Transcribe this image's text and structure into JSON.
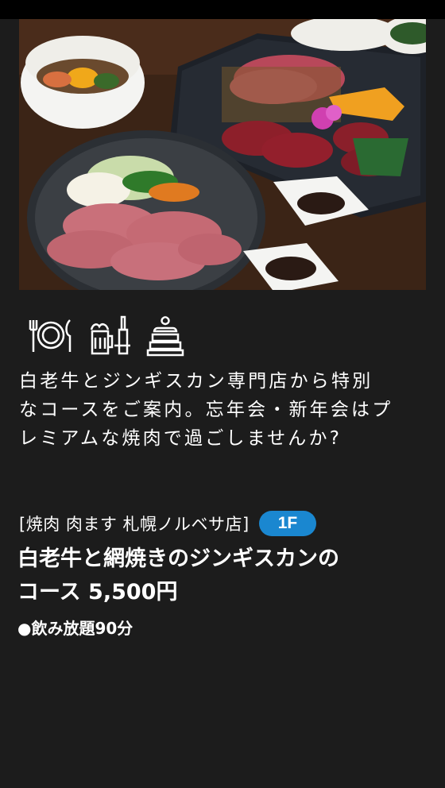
{
  "photo": {
    "alt": ""
  },
  "icons": [
    {
      "name": "dining-plate-icon"
    },
    {
      "name": "beer-drinks-icon"
    },
    {
      "name": "layer-cake-icon"
    }
  ],
  "description": {
    "line1": "白老牛とジンギスカン専門店から特別",
    "line2": "なコースをご案内。忘年会・新年会はプ",
    "line3": "レミアムな焼肉で過ごしませんか?"
  },
  "venue": {
    "name": "[焼肉 肉ます 札幌ノルベサ店]",
    "floor": "1F"
  },
  "course": {
    "title_line1": "白老牛と網焼きのジンギスカンの",
    "title_line2": "コース 5,500円"
  },
  "note": "●飲み放題90分",
  "colors": {
    "background": "#1c1c1c",
    "badge": "#1a87d0",
    "text": "#ffffff"
  }
}
